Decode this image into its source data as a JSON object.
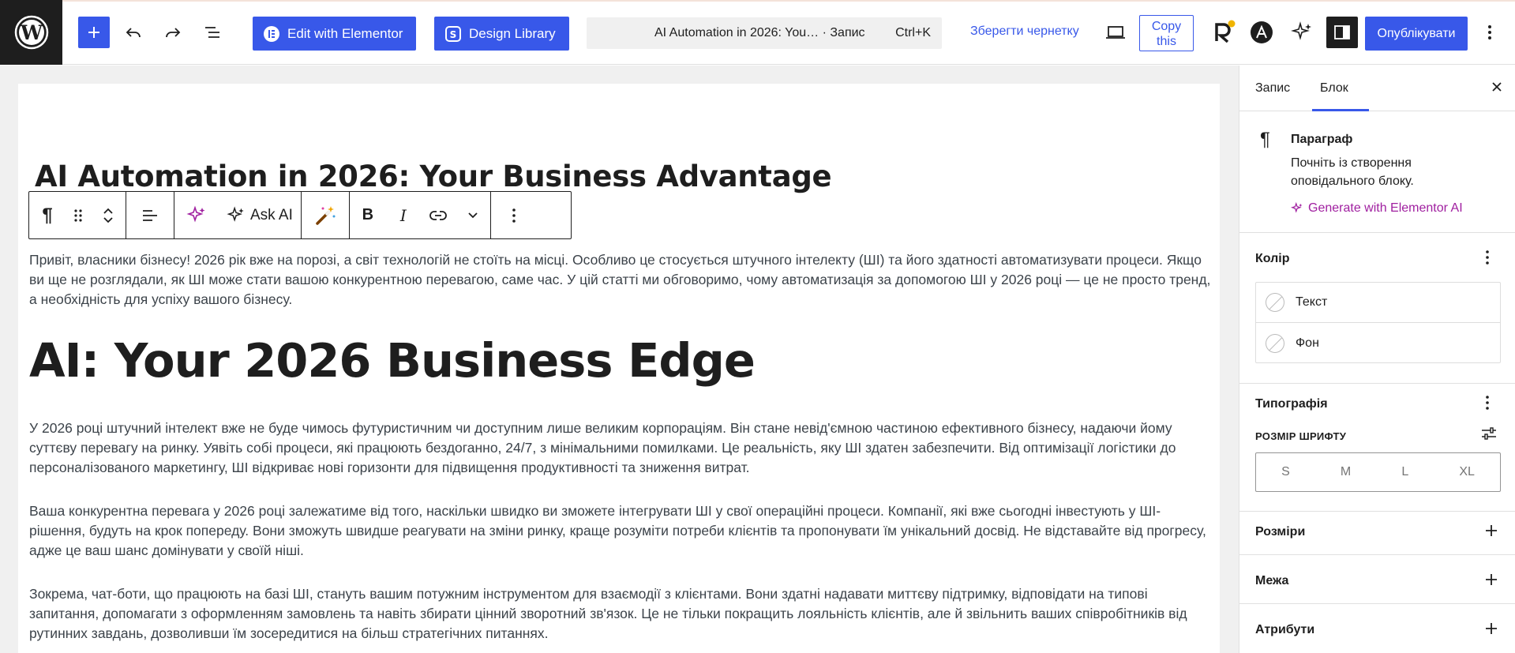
{
  "topbar": {
    "elementor_label": "Edit with Elementor",
    "design_library_label": "Design Library",
    "command_title": "AI Automation in 2026: You… · Запис",
    "command_shortcut": "Ctrl+K",
    "save_draft_label": "Зберегти чернетку",
    "copy_label_line1": "Copy",
    "copy_label_line2": "this",
    "publish_label": "Опублікувати"
  },
  "editor": {
    "post_title": "AI Automation in 2026: Your Business Advantage",
    "block_toolbar": {
      "ask_ai_label": "Ask AI"
    },
    "paragraph_1": "Привіт, власники бізнесу! 2026 рік вже на порозі, а світ технологій не стоїть на місці. Особливо це стосується штучного інтелекту (ШІ) та його здатності автоматизувати процеси. Якщо ви ще не розглядали, як ШІ може стати вашою конкурентною перевагою, саме час. У цій статті ми обговоримо, чому автоматизація за допомогою ШІ у 2026 році — це не просто тренд, а необхідність для успіху вашого бізнесу.",
    "heading_2": "AI: Your 2026 Business Edge",
    "paragraph_2": "У 2026 році штучний інтелект вже не буде чимось футуристичним чи доступним лише великим корпораціям. Він стане невід'ємною частиною ефективного бізнесу, надаючи йому суттєву перевагу на ринку. Уявіть собі процеси, які працюють бездоганно, 24/7, з мінімальними помилками. Це реальність, яку ШІ здатен забезпечити. Від оптимізації логістики до персоналізованого маркетингу, ШІ відкриває нові горизонти для підвищення продуктивності та зниження витрат.",
    "paragraph_3": "Ваша конкурентна перевага у 2026 році залежатиме від того, наскільки швидко ви зможете інтегрувати ШІ у свої операційні процеси. Компанії, які вже сьогодні інвестують у ШІ-рішення, будуть на крок попереду. Вони зможуть швидше реагувати на зміни ринку, краще розуміти потреби клієнтів та пропонувати їм унікальний досвід. Не відставайте від прогресу, адже це ваш шанс домінувати у своїй ніші.",
    "paragraph_4": "Зокрема, чат-боти, що працюють на базі ШІ, стануть вашим потужним інструментом для взаємодії з клієнтами. Вони здатні надавати миттєву підтримку, відповідати на типові запитання, допомагати з оформленням замовлень та навіть збирати цінний зворотний зв'язок. Це не тільки покращить лояльність клієнтів, але й звільнить ваших співробітників від рутинних завдань, дозволивши їм зосередитися на більш стратегічних питаннях."
  },
  "sidebar": {
    "tab_post": "Запис",
    "tab_block": "Блок",
    "block_name": "Параграф",
    "block_description": "Почніть із створення оповідального блоку.",
    "generate_ai_label": "Generate with Elementor AI",
    "color_title": "Колір",
    "color_text": "Текст",
    "color_background": "Фон",
    "typography_title": "Типографія",
    "font_size_label": "РОЗМІР ШРИФТУ",
    "font_sizes": [
      "S",
      "M",
      "L",
      "XL"
    ],
    "dimensions_title": "Розміри",
    "border_title": "Межа",
    "attributes_title": "Атрибути"
  },
  "colors": {
    "accent": "#3858e9",
    "elementor_ai": "#a020a0",
    "dark": "#1e1e1e"
  }
}
